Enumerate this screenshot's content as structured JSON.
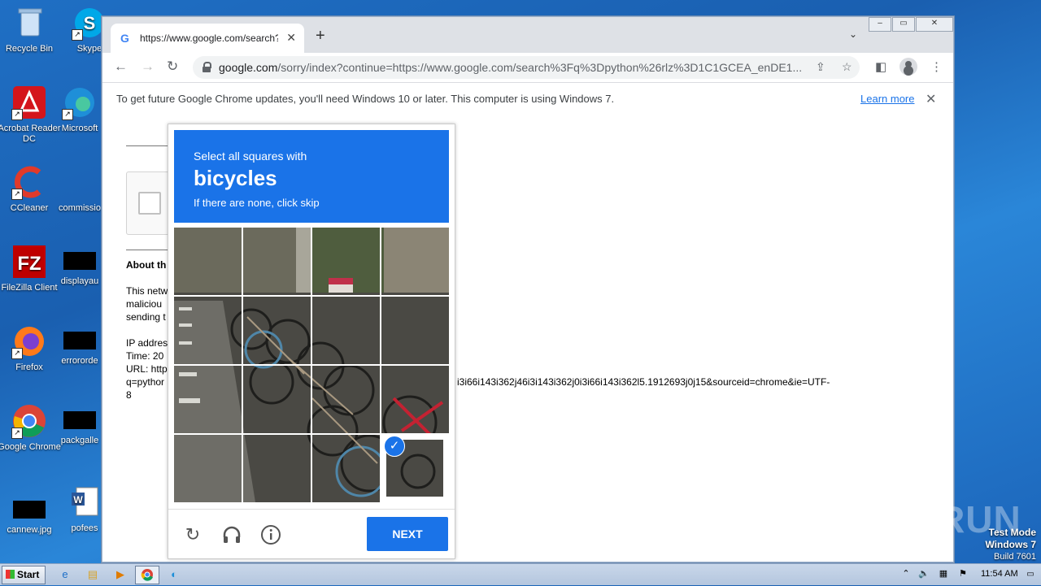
{
  "desktop": {
    "icons": [
      {
        "label": "Recycle Bin"
      },
      {
        "label": "Skype"
      },
      {
        "label": "Acrobat Reader DC"
      },
      {
        "label": "Microsoft"
      },
      {
        "label": "CCleaner"
      },
      {
        "label": "commissio"
      },
      {
        "label": "FileZilla Client"
      },
      {
        "label": "displayau"
      },
      {
        "label": "Firefox"
      },
      {
        "label": "errororde"
      },
      {
        "label": "Google Chrome"
      },
      {
        "label": "packgalle"
      },
      {
        "label": "cannew.jpg"
      },
      {
        "label": "pofees"
      }
    ]
  },
  "browser": {
    "tab_title": "https://www.google.com/search?q=",
    "url_host": "google.com",
    "url_path": "/sorry/index?continue=https://www.google.com/search%3Fq%3Dpython%26rlz%3D1C1GCEA_enDE1...",
    "window_controls": {
      "minimize": "–",
      "restore": "▭",
      "close": "✕"
    }
  },
  "infobar": {
    "message": "To get future Google Chrome updates, you'll need Windows 10 or later. This computer is using Windows 7.",
    "learn_more": "Learn more"
  },
  "page": {
    "about_heading": "About th",
    "para1": [
      "This netw",
      "maliciou",
      "sending t"
    ],
    "para2": [
      "IP addres",
      "Time: 20",
      "URL: http",
      "q=pythor"
    ],
    "url_tail": "i3i66i143i362j46i3i143i362j0i3i66i143i362l5.1912693j0j15&sourceid=chrome&ie=UTF-",
    "url_wrap": "8"
  },
  "captcha": {
    "instruction_line1": "Select all squares with",
    "target": "bicycles",
    "instruction_line3": "If there are none, click skip",
    "next_label": "NEXT",
    "selected_tile": "row 4, column 4"
  },
  "taskbar": {
    "start_label": "Start",
    "time": "11:54 AM"
  },
  "overlay": {
    "watermark": "ANY RUN",
    "testmode_line1": "Test Mode",
    "testmode_line2": "Windows 7",
    "testmode_line3": "Build 7601"
  }
}
